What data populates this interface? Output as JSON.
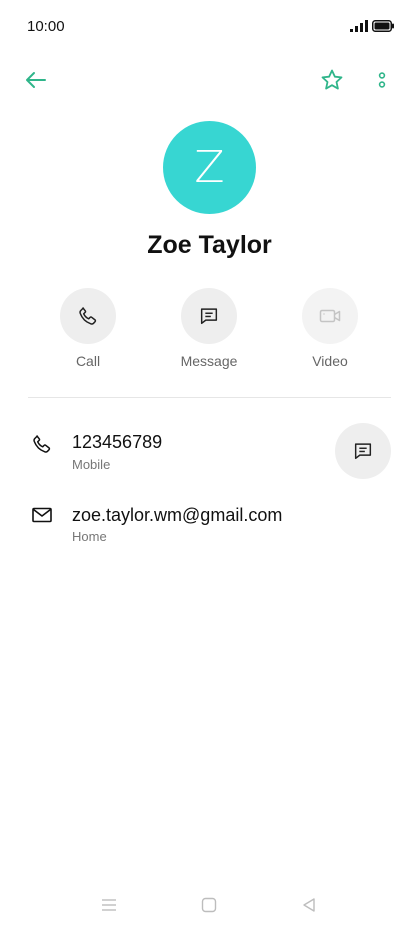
{
  "status_bar": {
    "time": "10:00",
    "icons": [
      "signal-icon",
      "battery-icon"
    ]
  },
  "toolbar": {
    "icons": [
      "back-arrow-icon",
      "star-icon",
      "more-vert-icon"
    ],
    "accent_color": "#2fb58a"
  },
  "contact": {
    "initial": "Z",
    "name": "Zoe Taylor",
    "avatar_color": "#37d6d2"
  },
  "actions": [
    {
      "label": "Call",
      "icon": "phone-icon",
      "enabled": true
    },
    {
      "label": "Message",
      "icon": "message-icon",
      "enabled": true
    },
    {
      "label": "Video",
      "icon": "video-icon",
      "enabled": false
    }
  ],
  "details": {
    "phone": {
      "value": "123456789",
      "type": "Mobile",
      "icon": "phone-icon",
      "action_icon": "message-icon"
    },
    "email": {
      "value": "zoe.taylor.wm@gmail.com",
      "type": "Home",
      "icon": "mail-icon"
    }
  },
  "nav_bar": {
    "icons": [
      "menu-icon",
      "home-icon",
      "back-icon"
    ]
  }
}
